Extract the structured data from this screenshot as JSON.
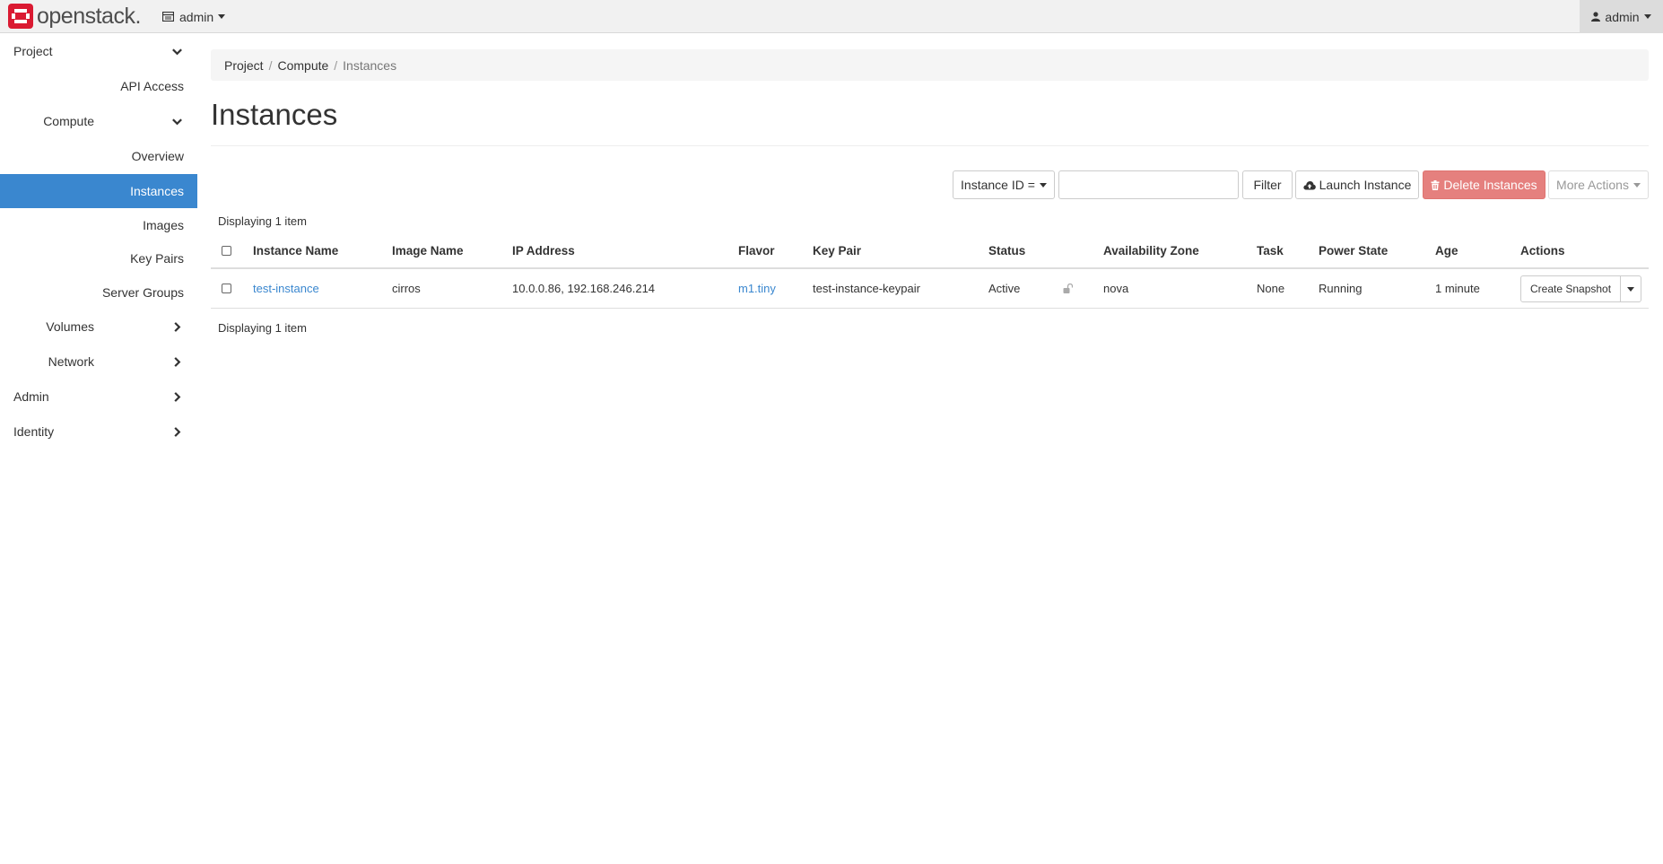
{
  "brand": {
    "name": "openstack",
    "dot": ".",
    "logo_color": "#da1a32"
  },
  "topnav": {
    "project_label": "admin",
    "user_label": "admin"
  },
  "sidebar": {
    "project": "Project",
    "api_access": "API Access",
    "compute": "Compute",
    "overview": "Overview",
    "instances": "Instances",
    "images": "Images",
    "key_pairs": "Key Pairs",
    "server_groups": "Server Groups",
    "volumes": "Volumes",
    "network": "Network",
    "admin": "Admin",
    "identity": "Identity"
  },
  "breadcrumb": [
    "Project",
    "Compute",
    "Instances"
  ],
  "page": {
    "title": "Instances"
  },
  "toolbar": {
    "filter_field": "Instance ID =",
    "filter_value": "",
    "filter_label": "Filter",
    "launch_label": "Launch Instance",
    "delete_label": "Delete Instances",
    "more_label": "More Actions"
  },
  "table": {
    "count_top": "Displaying 1 item",
    "count_bottom": "Displaying 1 item",
    "headers": {
      "name": "Instance Name",
      "image": "Image Name",
      "ip": "IP Address",
      "flavor": "Flavor",
      "keypair": "Key Pair",
      "status": "Status",
      "zone": "Availability Zone",
      "task": "Task",
      "power": "Power State",
      "age": "Age",
      "actions": "Actions"
    },
    "rows": [
      {
        "name": "test-instance",
        "image": "cirros",
        "ip": "10.0.0.86, 192.168.246.214",
        "flavor": "m1.tiny",
        "keypair": "test-instance-keypair",
        "status": "Active",
        "zone": "nova",
        "task": "None",
        "power": "Running",
        "age": "1 minute",
        "action": "Create Snapshot"
      }
    ]
  },
  "colors": {
    "accent": "#3a87cf",
    "danger": "#e5807e"
  }
}
